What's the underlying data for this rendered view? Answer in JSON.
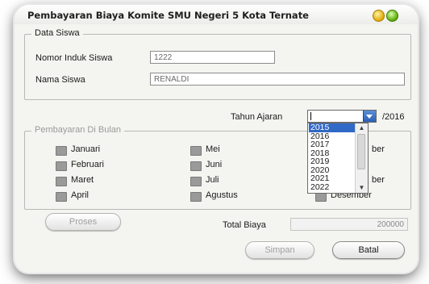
{
  "window": {
    "title": "Pembayaran Biaya Komite SMU Negeri 5 Kota Ternate"
  },
  "data_siswa": {
    "group_title": "Data Siswa",
    "nis_label": "Nomor Induk Siswa",
    "nis_value": "1222",
    "nama_label": "Nama Siswa",
    "nama_value": "RENALDI"
  },
  "tahun_ajaran": {
    "label": "Tahun Ajaran",
    "suffix": "/2016",
    "options": [
      "2015",
      "2016",
      "2017",
      "2018",
      "2019",
      "2020",
      "2021",
      "2022"
    ],
    "highlighted": "2015"
  },
  "pembayaran": {
    "group_title": "Pembayaran Di Bulan",
    "months": {
      "januari": "Januari",
      "februari": "Februari",
      "maret": "Maret",
      "april": "April",
      "mei": "Mei",
      "juni": "Juni",
      "juli": "Juli",
      "agustus": "Agustus",
      "sept_partial": "ber",
      "nov_partial": "ber",
      "desember": "Desember"
    }
  },
  "actions": {
    "proses": "Proses",
    "total_label": "Total Biaya",
    "total_value": "200000",
    "simpan": "Simpan",
    "batal": "Batal"
  }
}
